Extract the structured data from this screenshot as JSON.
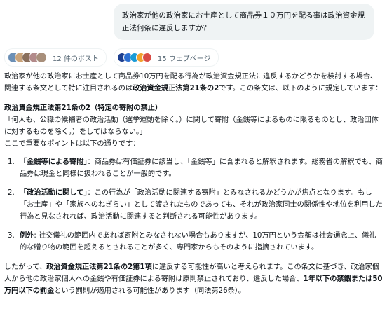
{
  "user_message": "政治家が他の政治家にお土産として商品券１０万円を配る事は政治資金規正法何条に違反しますか？",
  "sources": {
    "posts_label": "12 件のポスト",
    "pages_label": "15 ウェブページ",
    "avatar_colors": [
      "#6b8fb5",
      "#c9a37a",
      "#8a6f5c",
      "#b28a8a",
      "#a88f7b"
    ],
    "favicon_colors": [
      "#1d3f8f",
      "#2c6fd1",
      "#1a9bd7",
      "#f2a12d",
      "#d94b45"
    ]
  },
  "answer": {
    "intro_1": "政治家が他の政治家にお土産として商品券10万円を配る行為が政治資金規正法に違反するかどうかを検討する場合、関連する条文として特に注目されるのは",
    "intro_bold": "政治資金規正法第21条の2",
    "intro_2": "です。この条文は、以下のように規定しています：",
    "heading": "政治資金規正法第21条の2（特定の寄附の禁止）",
    "quote": "「何人も、公職の候補者の政治活動（選挙運動を除く。）に関して寄附（金銭等によるものに限るものとし、政治団体に対するものを除く。）をしてはならない。」",
    "points_intro": "ここで重要なポイントは以下の通りです：",
    "points": [
      {
        "bold": "「金銭等による寄附」",
        "text": "：商品券は有価証券に該当し、「金銭等」に含まれると解釈されます。総務省の解釈でも、商品券は現金と同様に扱われることが一般的です。"
      },
      {
        "bold": "「政治活動に関して」",
        "text": "：この行為が「政治活動に関連する寄附」とみなされるかどうかが焦点となります。もし「お土産」や「家族へのねぎらい」として渡されたものであっても、それが政治家同士の関係性や地位を利用した行為と見なされれば、政治活動に関連すると判断される可能性があります。"
      },
      {
        "bold": "例外",
        "text": ": 社交儀礼の範囲内であれば寄附とみなされない場合もありますが、10万円という金額は社会通念上、儀礼的な贈り物の範囲を超えるとされることが多く、専門家からもそのように指摘されています。"
      }
    ],
    "concl_1": "したがって、",
    "concl_bold_1": "政治資金規正法第21条の2第1項",
    "concl_2": "に違反する可能性が高いと考えられます。この条文に基づき、政治家個人から他の政治家個人への金銭や有価証券による寄附は原則禁止されており、違反した場合、",
    "concl_bold_2": "1年以下の禁錮または50万円以下の罰金",
    "concl_3": "という罰則が適用される可能性があります（同法第26条）。"
  }
}
